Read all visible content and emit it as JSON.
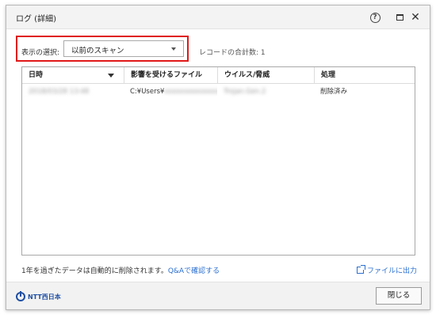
{
  "window": {
    "title": "ログ (詳細)"
  },
  "titlebar": {
    "help_glyph": "?",
    "icons": [
      "help-icon",
      "maximize-icon",
      "close-icon"
    ]
  },
  "filter": {
    "label": "表示の選択:",
    "selected": "以前のスキャン"
  },
  "record_count": "レコードの合計数: 1",
  "table": {
    "columns": [
      "日時",
      "影響を受けるファイル",
      "ウイルス/脅威",
      "処理"
    ],
    "rows": [
      {
        "datetime": "2018/03/28 13:48",
        "file": "C:¥Users¥",
        "file_hidden": "xxxxxxxxxxxxxxxx",
        "threat": "Trojan.Gen.2",
        "action": "削除済み"
      }
    ]
  },
  "retention": {
    "text": "1年を過ぎたデータは自動的に削除されます。",
    "link": "Q&Aで確認する"
  },
  "export_link": "ファイルに出力",
  "footer": {
    "logo_text": "NTT西日本",
    "close_label": "閉じる"
  },
  "colors": {
    "accent": "#2a6fd1",
    "highlight": "#e01818",
    "logo": "#1f4fa3"
  }
}
